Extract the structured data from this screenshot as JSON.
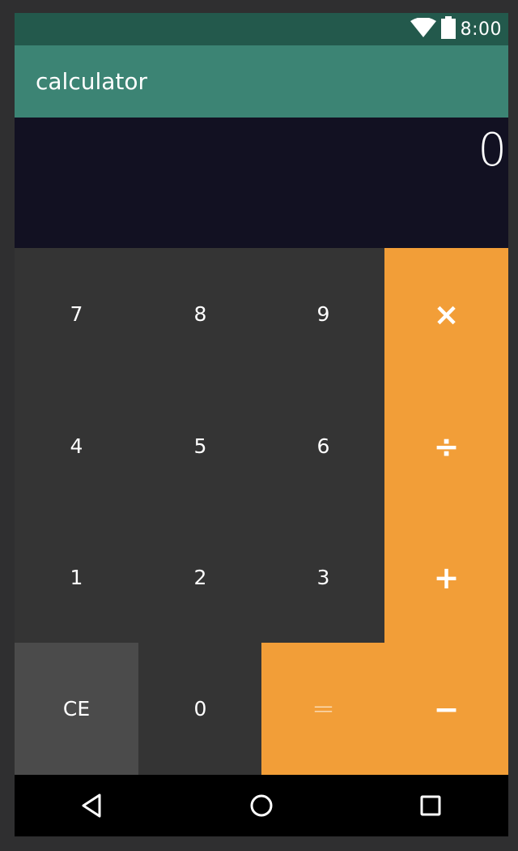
{
  "status_bar": {
    "time": "8:00",
    "icons": [
      "wifi-icon",
      "battery-icon"
    ]
  },
  "app_bar": {
    "title": "calculator"
  },
  "display": {
    "value": "0"
  },
  "keypad": {
    "rows": [
      [
        "7",
        "8",
        "9",
        "×"
      ],
      [
        "4",
        "5",
        "6",
        "÷"
      ],
      [
        "1",
        "2",
        "3",
        "+"
      ],
      [
        "CE",
        "0",
        "=",
        "−"
      ]
    ]
  },
  "nav_bar": {
    "icons": [
      "back-icon",
      "home-icon",
      "recents-icon"
    ]
  },
  "colors": {
    "status_bar": "#23594c",
    "app_bar": "#3c8474",
    "display_bg": "#121122",
    "keypad_bg": "#343434",
    "operator": "#f29e38",
    "ce_key": "#4b4b4b"
  }
}
